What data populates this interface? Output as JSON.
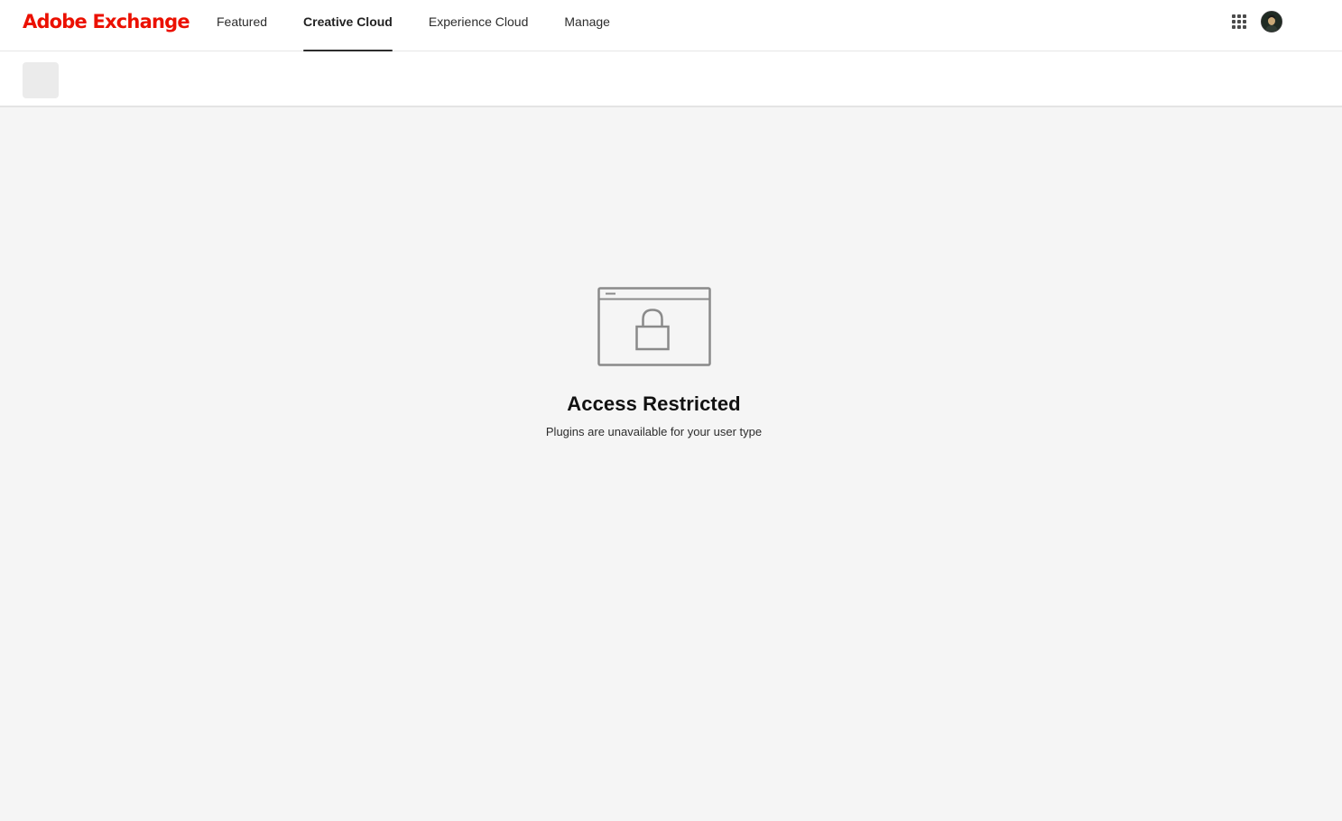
{
  "header": {
    "brand": "Adobe Exchange",
    "tabs": [
      {
        "label": "Featured",
        "active": false
      },
      {
        "label": "Creative Cloud",
        "active": true
      },
      {
        "label": "Experience Cloud",
        "active": false
      },
      {
        "label": "Manage",
        "active": false
      }
    ],
    "apps_icon": "app-grid-icon",
    "avatar_icon": "user-avatar"
  },
  "empty_state": {
    "icon": "locked-window-icon",
    "title": "Access Restricted",
    "message": "Plugins are unavailable for your user type"
  },
  "colors": {
    "brand": "#eb1000",
    "background": "#f5f5f5",
    "header": "#ffffff",
    "icon_stroke": "#8a8a8a"
  }
}
